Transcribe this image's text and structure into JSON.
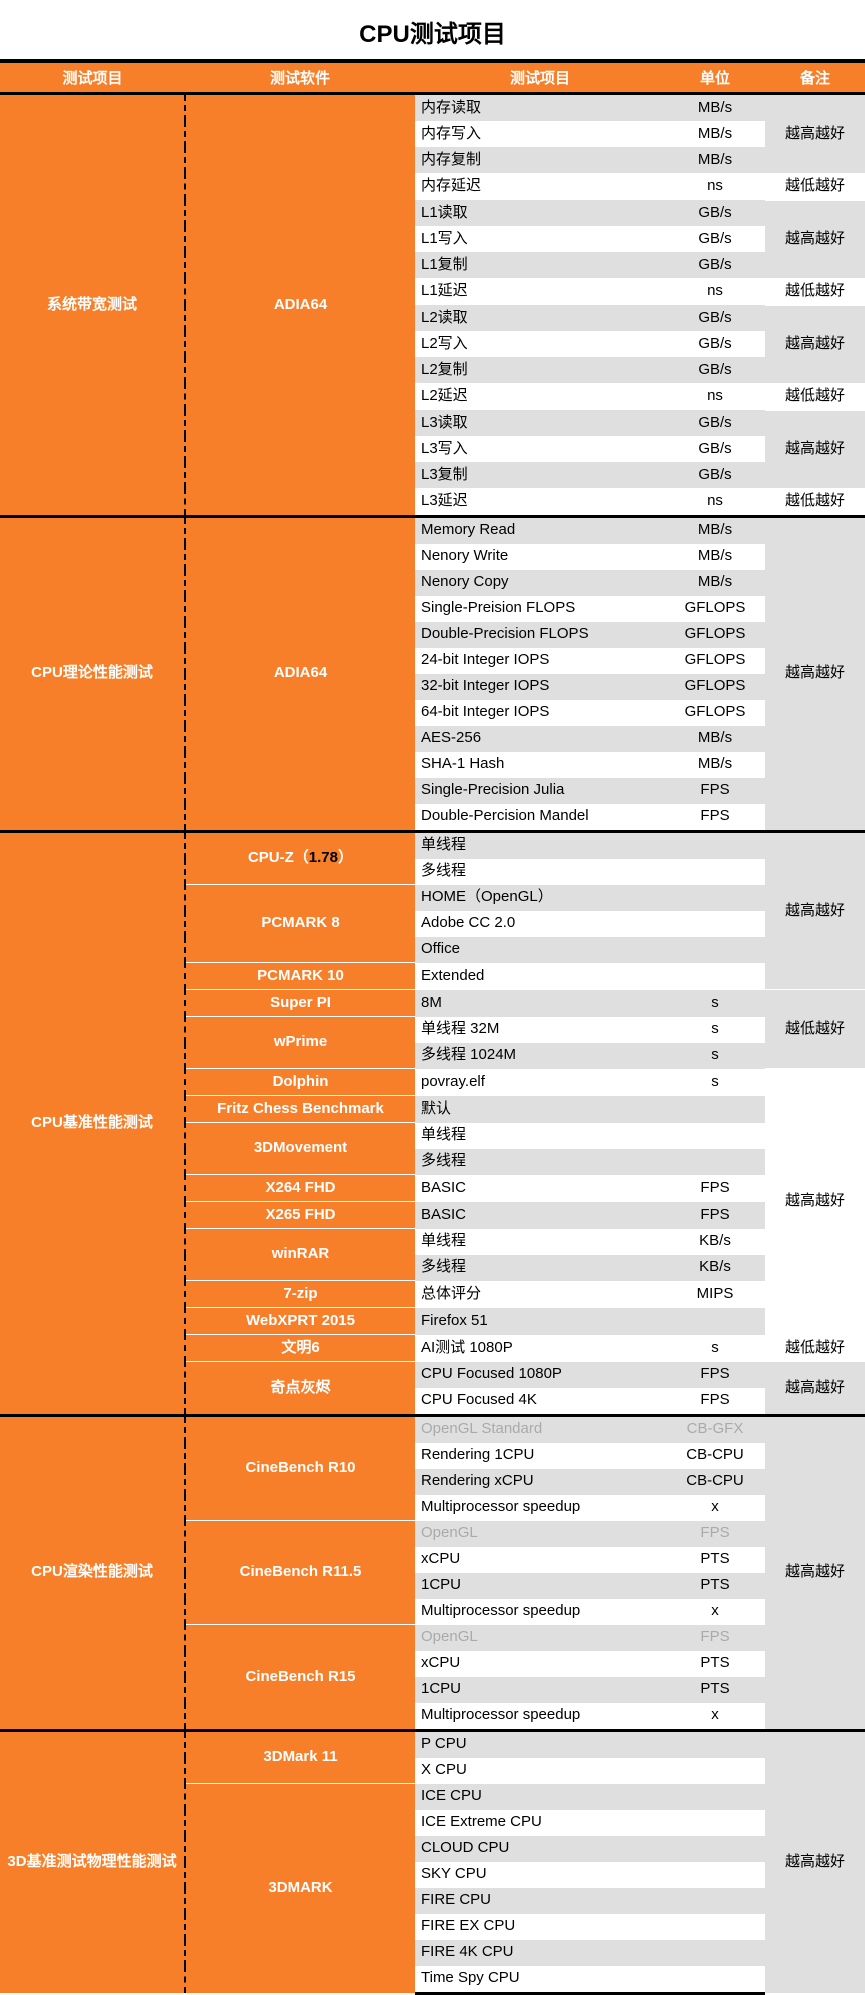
{
  "title": "CPU测试项目",
  "headers": {
    "c1": "测试项目",
    "c2": "测试软件",
    "c3": "测试项目",
    "c4": "单位",
    "c5": "备注"
  },
  "notes": {
    "higher": "越高越好",
    "lower": "越低越好"
  },
  "sections": [
    {
      "category": "系统带宽测试",
      "software": [
        {
          "name": "ADIA64",
          "rows": [
            {
              "item": "内存读取",
              "unit": "MB/s"
            },
            {
              "item": "内存写入",
              "unit": "MB/s"
            },
            {
              "item": "内存复制",
              "unit": "MB/s"
            },
            {
              "item": "内存延迟",
              "unit": "ns"
            },
            {
              "item": "L1读取",
              "unit": "GB/s"
            },
            {
              "item": "L1写入",
              "unit": "GB/s"
            },
            {
              "item": "L1复制",
              "unit": "GB/s"
            },
            {
              "item": "L1延迟",
              "unit": "ns"
            },
            {
              "item": "L2读取",
              "unit": "GB/s"
            },
            {
              "item": "L2写入",
              "unit": "GB/s"
            },
            {
              "item": "L2复制",
              "unit": "GB/s"
            },
            {
              "item": "L2延迟",
              "unit": "ns"
            },
            {
              "item": "L3读取",
              "unit": "GB/s"
            },
            {
              "item": "L3写入",
              "unit": "GB/s"
            },
            {
              "item": "L3复制",
              "unit": "GB/s"
            },
            {
              "item": "L3延迟",
              "unit": "ns"
            }
          ]
        }
      ]
    },
    {
      "category": "CPU理论性能测试",
      "software": [
        {
          "name": "ADIA64",
          "rows": [
            {
              "item": "Memory Read",
              "unit": "MB/s"
            },
            {
              "item": "Nenory Write",
              "unit": "MB/s"
            },
            {
              "item": "Nenory Copy",
              "unit": "MB/s"
            },
            {
              "item": "Single-Preision FLOPS",
              "unit": "GFLOPS"
            },
            {
              "item": "Double-Precision FLOPS",
              "unit": "GFLOPS"
            },
            {
              "item": "24-bit Integer IOPS",
              "unit": "GFLOPS"
            },
            {
              "item": "32-bit Integer IOPS",
              "unit": "GFLOPS"
            },
            {
              "item": "64-bit Integer IOPS",
              "unit": "GFLOPS"
            },
            {
              "item": "AES-256",
              "unit": "MB/s"
            },
            {
              "item": "SHA-1 Hash",
              "unit": "MB/s"
            },
            {
              "item": "Single-Precision Julia",
              "unit": "FPS"
            },
            {
              "item": "Double-Percision Mandel",
              "unit": "FPS"
            }
          ]
        }
      ]
    },
    {
      "category": "CPU基准性能测试",
      "software": [
        {
          "name": "CPU-Z（",
          "version": "1.78",
          "suffix": "）",
          "rows": [
            {
              "item": "单线程",
              "unit": ""
            },
            {
              "item": "多线程",
              "unit": ""
            }
          ]
        },
        {
          "name": "PCMARK 8",
          "rows": [
            {
              "item": "HOME（OpenGL）",
              "unit": ""
            },
            {
              "item": "Adobe CC 2.0",
              "unit": ""
            },
            {
              "item": "Office",
              "unit": ""
            }
          ]
        },
        {
          "name": "PCMARK 10",
          "rows": [
            {
              "item": "Extended",
              "unit": ""
            }
          ]
        },
        {
          "name": "Super PI",
          "rows": [
            {
              "item": "8M",
              "unit": "s"
            }
          ]
        },
        {
          "name": "wPrime",
          "rows": [
            {
              "item": "单线程 32M",
              "unit": "s"
            },
            {
              "item": "多线程 1024M",
              "unit": "s"
            }
          ]
        },
        {
          "name": "Dolphin",
          "rows": [
            {
              "item": "povray.elf",
              "unit": "s"
            }
          ]
        },
        {
          "name": "Fritz Chess Benchmark",
          "rows": [
            {
              "item": "默认",
              "unit": ""
            }
          ]
        },
        {
          "name": "3DMovement",
          "rows": [
            {
              "item": "单线程",
              "unit": ""
            },
            {
              "item": "多线程",
              "unit": ""
            }
          ]
        },
        {
          "name": "X264 FHD",
          "rows": [
            {
              "item": "BASIC",
              "unit": "FPS"
            }
          ]
        },
        {
          "name": "X265 FHD",
          "rows": [
            {
              "item": "BASIC",
              "unit": "FPS"
            }
          ]
        },
        {
          "name": "winRAR",
          "rows": [
            {
              "item": "单线程",
              "unit": "KB/s"
            },
            {
              "item": "多线程",
              "unit": "KB/s"
            }
          ]
        },
        {
          "name": "7-zip",
          "rows": [
            {
              "item": "总体评分",
              "unit": "MIPS"
            }
          ]
        },
        {
          "name": "WebXPRT 2015",
          "rows": [
            {
              "item": "Firefox 51",
              "unit": ""
            }
          ]
        },
        {
          "name": "文明6",
          "rows": [
            {
              "item": "AI测试 1080P",
              "unit": "s"
            }
          ]
        },
        {
          "name": "奇点灰烬",
          "rows": [
            {
              "item": "CPU Focused 1080P",
              "unit": "FPS"
            },
            {
              "item": "CPU Focused 4K",
              "unit": "FPS"
            }
          ]
        }
      ]
    },
    {
      "category": "CPU渲染性能测试",
      "software": [
        {
          "name": "CineBench R10",
          "rows": [
            {
              "item": "OpenGL Standard",
              "unit": "CB-GFX",
              "gray": true
            },
            {
              "item": "Rendering 1CPU",
              "unit": "CB-CPU"
            },
            {
              "item": "Rendering xCPU",
              "unit": "CB-CPU"
            },
            {
              "item": "Multiprocessor speedup",
              "unit": "x"
            }
          ]
        },
        {
          "name": "CineBench R11.5",
          "rows": [
            {
              "item": "OpenGL",
              "unit": "FPS",
              "gray": true
            },
            {
              "item": "xCPU",
              "unit": "PTS"
            },
            {
              "item": "1CPU",
              "unit": "PTS"
            },
            {
              "item": "Multiprocessor speedup",
              "unit": "x"
            }
          ]
        },
        {
          "name": "CineBench R15",
          "rows": [
            {
              "item": "OpenGL",
              "unit": "FPS",
              "gray": true
            },
            {
              "item": "xCPU",
              "unit": "PTS"
            },
            {
              "item": "1CPU",
              "unit": "PTS"
            },
            {
              "item": "Multiprocessor speedup",
              "unit": "x"
            }
          ]
        }
      ]
    },
    {
      "category": "3D基准测试物理性能测试",
      "software": [
        {
          "name": "3DMark 11",
          "rows": [
            {
              "item": "P CPU",
              "unit": ""
            },
            {
              "item": "X CPU",
              "unit": ""
            }
          ]
        },
        {
          "name": "3DMARK",
          "rows": [
            {
              "item": "ICE CPU",
              "unit": ""
            },
            {
              "item": "ICE Extreme CPU",
              "unit": ""
            },
            {
              "item": "CLOUD CPU",
              "unit": ""
            },
            {
              "item": "SKY CPU",
              "unit": ""
            },
            {
              "item": "FIRE CPU",
              "unit": ""
            },
            {
              "item": "FIRE EX CPU",
              "unit": ""
            },
            {
              "item": "FIRE 4K CPU",
              "unit": ""
            },
            {
              "item": "Time Spy CPU",
              "unit": ""
            }
          ]
        }
      ]
    }
  ]
}
